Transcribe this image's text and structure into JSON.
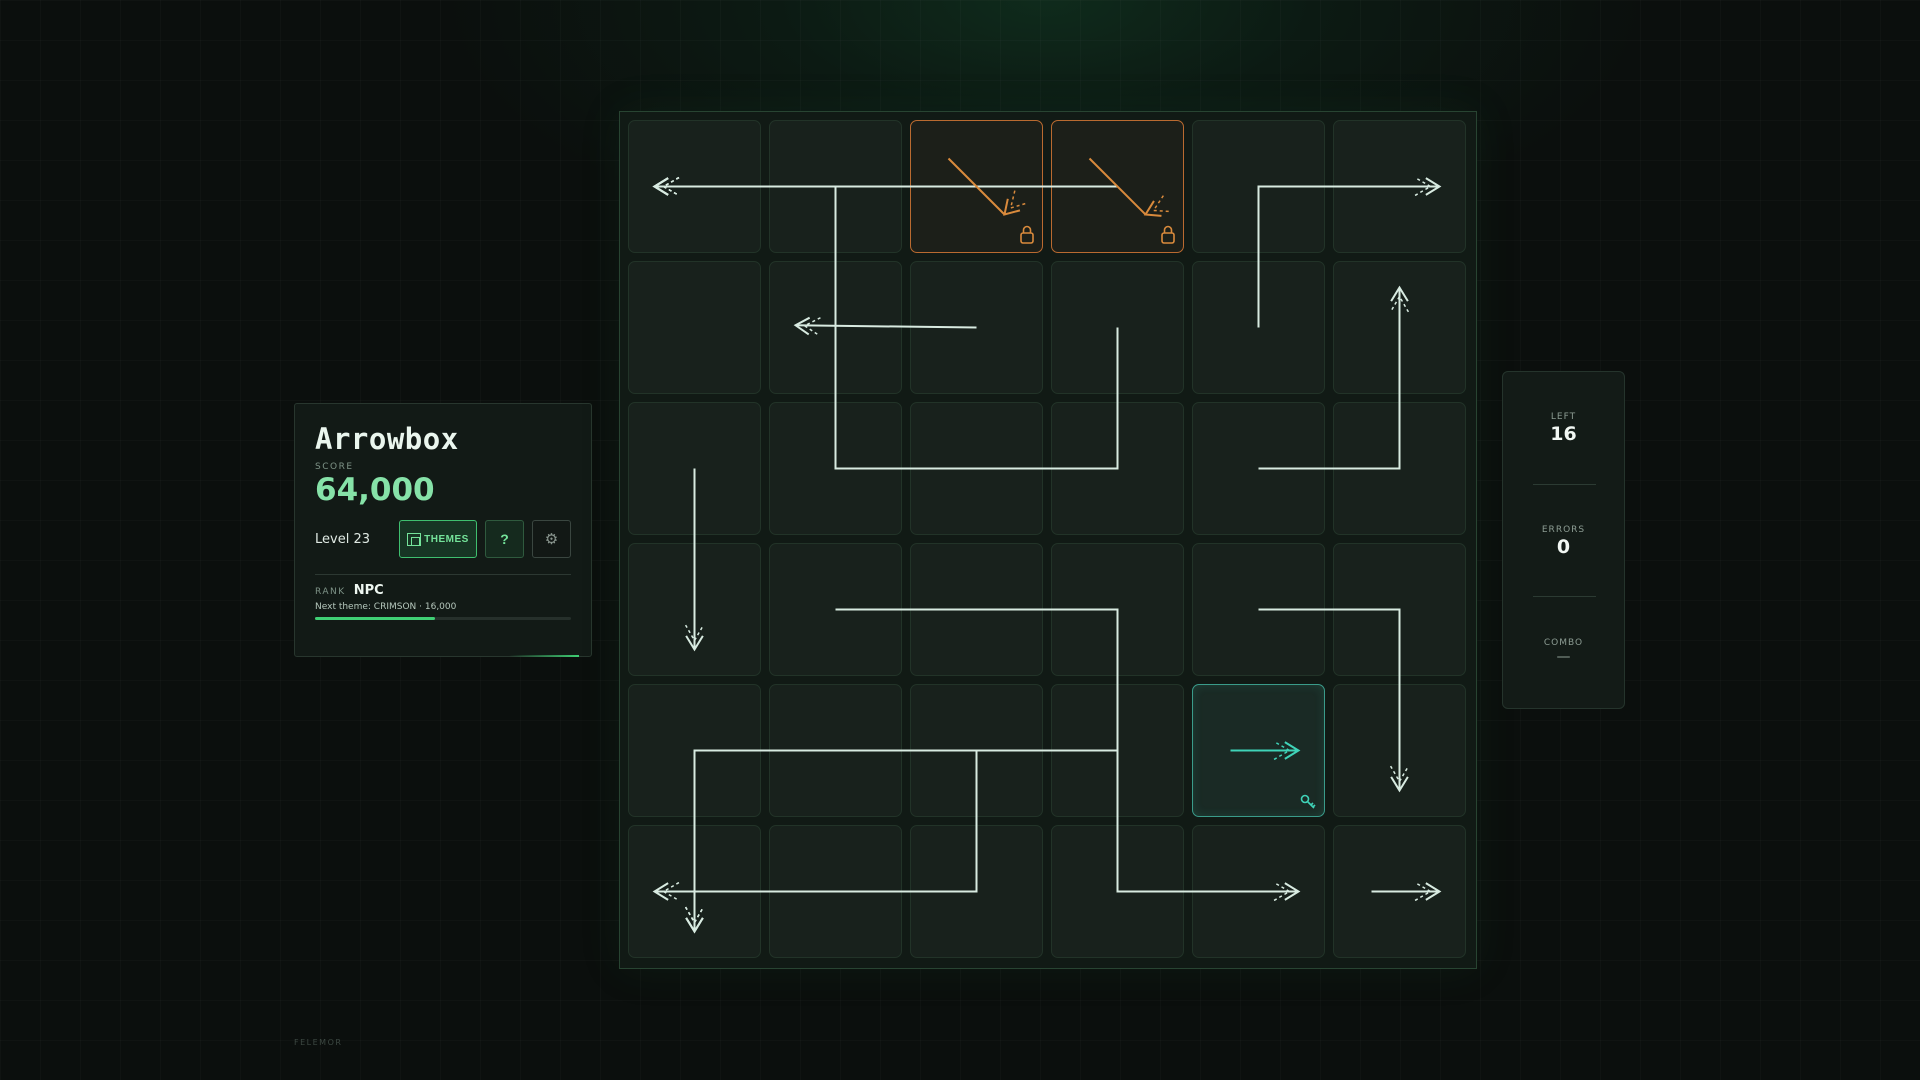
{
  "game": {
    "title": "Arrowbox",
    "score_label": "SCORE",
    "score": "64,000",
    "level_text": "Level 23",
    "themes_label": "THEMES",
    "help_label": "?",
    "settings_icon": "gear-icon",
    "rank_label": "RANK",
    "rank": "NPC",
    "next_theme": "Next theme: CRIMSON · 16,000",
    "next_theme_progress": 0.47
  },
  "stats": {
    "left_label": "LEFT",
    "left_value": "16",
    "errors_label": "ERRORS",
    "errors_value": "0",
    "combo_label": "COMBO",
    "combo_value": "—"
  },
  "footer": {
    "brand": "FELEMOR"
  },
  "colors": {
    "accent": "#3fcf74",
    "arrow": "#d8ebe1",
    "locked": "#d98a3c",
    "selected": "#3fd3b8"
  },
  "board": {
    "rows": 6,
    "cols": 6,
    "cells": [
      {
        "row": 0,
        "col": 2,
        "state": "locked"
      },
      {
        "row": 0,
        "col": 3,
        "state": "locked"
      },
      {
        "row": 4,
        "col": 4,
        "state": "selected"
      }
    ],
    "arrows": [
      {
        "path": [
          [
            2,
            0
          ],
          [
            0,
            0
          ]
        ],
        "color": "arrow"
      },
      {
        "path": [
          [
            1,
            0
          ],
          [
            0,
            0
          ]
        ],
        "color": "arrow"
      },
      {
        "path": [
          [
            0,
            2
          ],
          [
            0,
            3.05
          ]
        ],
        "color": "arrow"
      },
      {
        "path": [
          [
            3,
            0
          ],
          [
            0,
            0
          ]
        ],
        "color": "arrow"
      },
      {
        "path": [
          [
            0,
            4
          ],
          [
            0,
            4.85
          ]
        ],
        "color": "arrow"
      },
      {
        "path": [
          [
            0,
            4
          ],
          [
            0,
            4.85
          ]
        ],
        "color": "arrow"
      },
      {
        "path": [
          [
            3,
            5
          ],
          [
            3,
            4
          ],
          [
            0,
            4
          ],
          [
            0,
            5
          ]
        ],
        "color": "arrow"
      },
      {
        "path": [
          [
            2,
            0
          ],
          [
            1.1,
            0.95
          ]
        ],
        "color": "locked"
      },
      {
        "path": [
          [
            3,
            0
          ],
          [
            1.1,
            0.95
          ]
        ],
        "color": "locked"
      },
      {
        "path": [
          [
            2,
            1
          ],
          [
            1.1,
            0.95
          ]
        ],
        "color": "arrow"
      },
      {
        "path": [
          [
            3,
            1
          ],
          [
            3,
            2
          ],
          [
            1,
            2
          ],
          [
            1,
            0
          ],
          [
            0,
            0
          ]
        ],
        "color": "arrow"
      },
      {
        "path": [
          [
            4,
            1
          ],
          [
            4,
            0
          ],
          [
            5,
            0
          ]
        ],
        "color": "arrow"
      },
      {
        "path": [
          [
            4,
            2
          ],
          [
            5,
            2
          ],
          [
            5,
            1
          ]
        ],
        "color": "arrow"
      },
      {
        "path": [
          [
            1,
            3
          ],
          [
            3,
            3
          ],
          [
            3,
            5
          ],
          [
            4,
            5
          ]
        ],
        "color": "arrow"
      },
      {
        "path": [
          [
            4,
            3
          ],
          [
            5,
            3
          ],
          [
            5,
            4
          ]
        ],
        "color": "arrow"
      },
      {
        "path": [
          [
            4,
            4
          ],
          [
            4.2,
            4
          ]
        ],
        "color": "selected"
      },
      {
        "path": [
          [
            5,
            5
          ],
          [
            5.2,
            5
          ]
        ],
        "color": "arrow"
      },
      {
        "path": [
          [
            2,
            4
          ],
          [
            2,
            5
          ],
          [
            0,
            5
          ]
        ],
        "color": "arrow"
      }
    ]
  }
}
